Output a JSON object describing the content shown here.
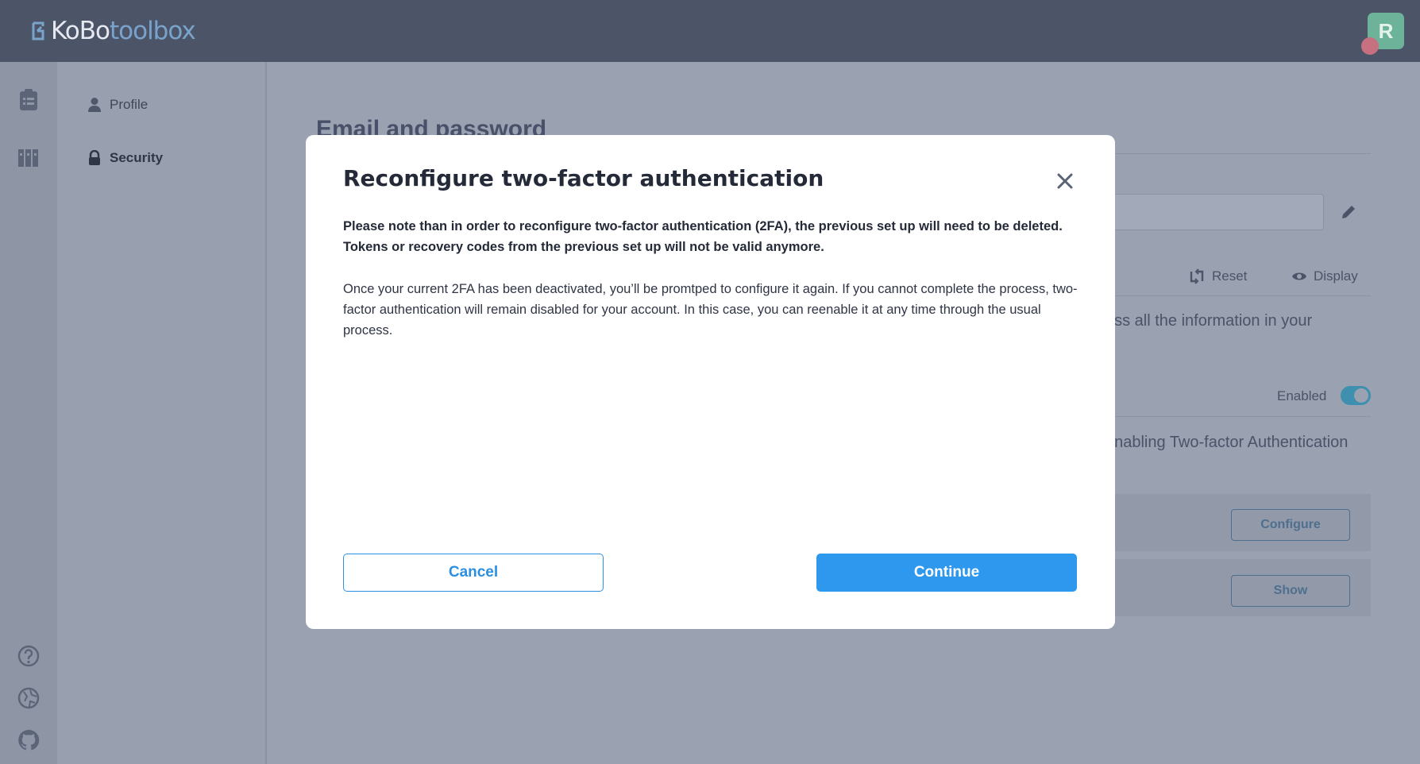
{
  "header": {
    "logo_part1": "KoBo",
    "logo_part2": "toolbox",
    "avatar_initial": "R"
  },
  "rail": {
    "top_icons": [
      "forms-icon",
      "library-icon"
    ],
    "bottom_icons": [
      "help-icon",
      "language-icon",
      "github-icon"
    ]
  },
  "sidebar": {
    "items": [
      {
        "label": "Profile",
        "icon": "user-icon"
      },
      {
        "label": "Security",
        "icon": "lock-icon",
        "active": true
      }
    ]
  },
  "main": {
    "section_title": "Email and password",
    "reset_label": "Reset",
    "display_label": "Display",
    "api_text_fragment": "ess all the information in your",
    "enabled_label": "Enabled",
    "twofa_text_fragment": "enabling Two-factor Authentication",
    "configure_label": "Configure",
    "show_label": "Show"
  },
  "modal": {
    "title": "Reconfigure two-factor authentication",
    "body_bold_line1": "Please note than in order to reconfigure two-factor authentication (2FA), the previous set up will need to be deleted.",
    "body_bold_line2": "Tokens or recovery codes from the previous set up will not be valid anymore.",
    "body_text": "Once your current 2FA has been deactivated, you’ll be promtped to configure it again. If you cannot complete the process, two-factor authentication will remain disabled for your account. In this case, you can reenable it at any time through the usual process.",
    "cancel_label": "Cancel",
    "continue_label": "Continue"
  },
  "colors": {
    "header_bg": "#4c5468",
    "overlay_bg": "#9aa1b1",
    "primary_blue": "#2d98ee",
    "modal_bg": "#ffffff"
  }
}
